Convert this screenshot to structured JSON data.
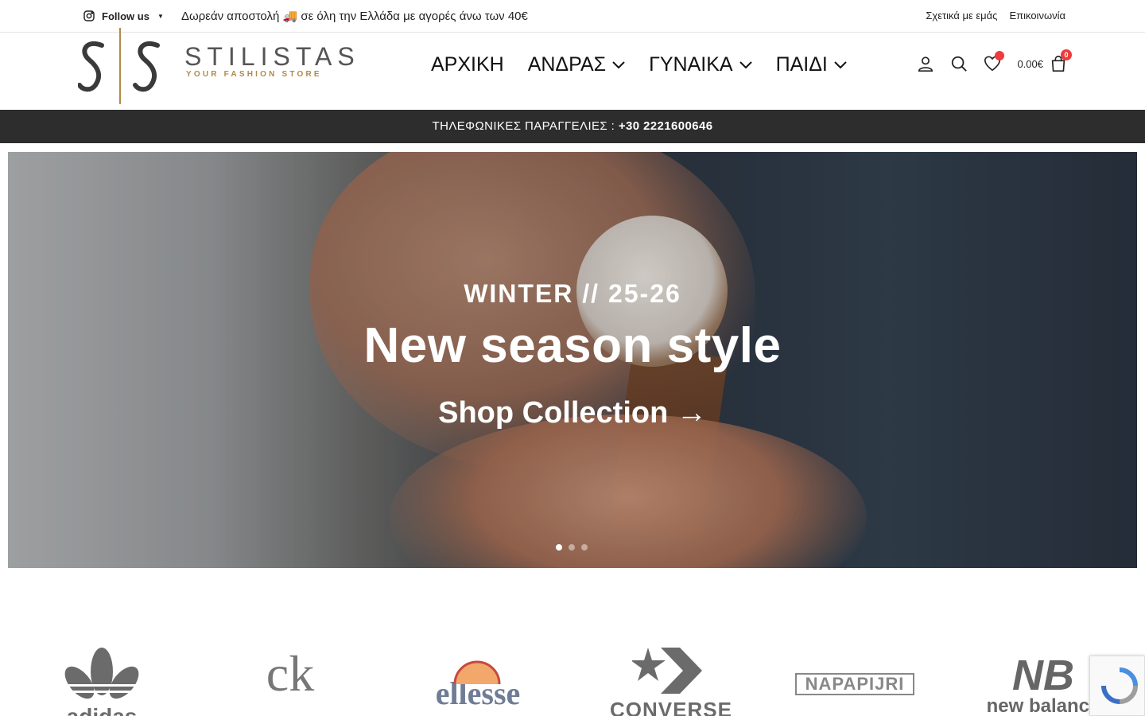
{
  "topbar": {
    "follow_label": "Follow us",
    "promo_text": "Δωρεάν αποστολή 🚚 σε όλη την Ελλάδα με αγορές άνω των 40€",
    "links": [
      "Σχετικά με εμάς",
      "Επικοινωνία"
    ]
  },
  "header": {
    "brand_name": "STILISTAS",
    "brand_tagline": "YOUR FASHION STORE",
    "nav": [
      {
        "label": "ΑΡΧΙΚΗ",
        "dropdown": false
      },
      {
        "label": "ΑΝΔΡΑΣ",
        "dropdown": true
      },
      {
        "label": "ΓΥΝΑΙΚΑ",
        "dropdown": true
      },
      {
        "label": "ΠΑΙΔΙ",
        "dropdown": true
      }
    ],
    "cart_total": "0.00€",
    "cart_count": "0",
    "icons": [
      "account-icon",
      "search-icon",
      "wishlist-icon",
      "cart-icon"
    ]
  },
  "phone_banner": {
    "label": "ΤΗΛΕΦΩΝΙΚΕΣ ΠΑΡΑΓΓΕΛΙΕΣ : ",
    "number": "+30 2221600646"
  },
  "hero": {
    "subtitle": "WINTER // 25-26",
    "title": "New season style",
    "cta": "Shop Collection →",
    "slides": 3,
    "active_slide": 1
  },
  "brands": {
    "adidas": "adidas",
    "ck": "ck",
    "ellesse": "ellesse",
    "converse": "CONVERSE",
    "napapijri": "NAPAPIJRI",
    "newbalance_mark": "NB",
    "newbalance": "new balance"
  },
  "colors": {
    "accent_gold": "#b08a48",
    "badge_red": "#ee3b3b",
    "phone_bar_bg": "#2d2d2d"
  }
}
